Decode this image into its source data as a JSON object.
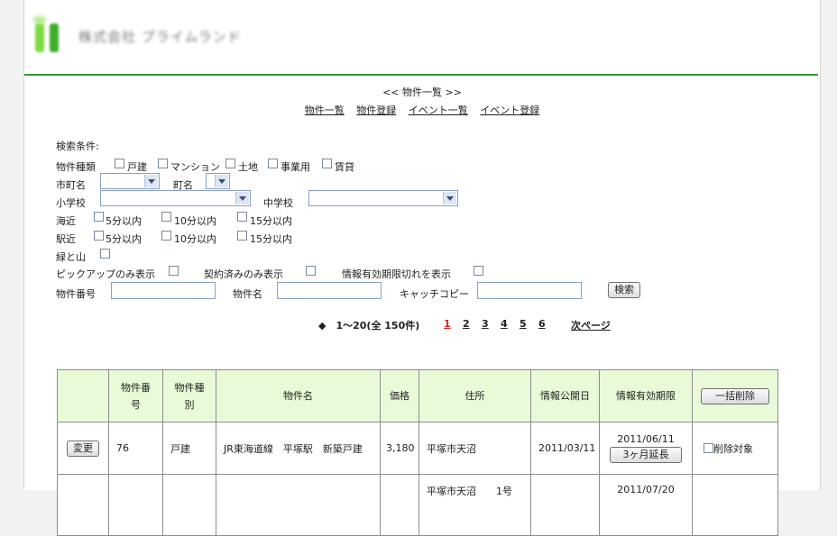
{
  "header": {
    "company_name": "株式会社 プライムランド"
  },
  "nav": {
    "title": "<< 物件一覧 >>",
    "links": [
      "物件一覧",
      "物件登録",
      "イベント一覧",
      "イベント登録"
    ]
  },
  "search": {
    "heading": "検索条件:",
    "type_label": "物件種類",
    "types": [
      "戸建",
      "マンション",
      "土地",
      "事業用",
      "賃貸"
    ],
    "city_label": "市町名",
    "town_label": "町名",
    "elem_school_label": "小学校",
    "mid_school_label": "中学校",
    "sea_label": "海近",
    "station_label": "駅近",
    "distance_options": [
      "5分以内",
      "10分以内",
      "15分以内"
    ],
    "green_label": "緑と山",
    "pickup_label": "ピックアップのみ表示",
    "contracted_label": "契約済みのみ表示",
    "expired_label": "情報有効期限切れを表示",
    "number_label": "物件番号",
    "name_label": "物件名",
    "catch_label": "キャッチコピー",
    "search_button": "検索"
  },
  "pager": {
    "range": "◆　1〜20(全 150件)",
    "pages": [
      "1",
      "2",
      "3",
      "4",
      "5",
      "6"
    ],
    "current": "1",
    "next": "次ページ"
  },
  "table": {
    "headers": [
      "",
      "物件番号",
      "物件種別",
      "物件名",
      "価格",
      "住所",
      "情報公開日",
      "情報有効期限"
    ],
    "bulk_delete_button": "一括削除",
    "rows": [
      {
        "edit_button": "変更",
        "number": "76",
        "type": "戸建",
        "name": "JR東海道線　平塚駅　新築戸建",
        "price": "3,180",
        "address": "平塚市天沼",
        "published": "2011/03/11",
        "expires": "2011/06/11",
        "extend_button": "3ヶ月延長",
        "delete_label": "削除対象"
      },
      {
        "address": "平塚市天沼　　1号",
        "expires": "2011/07/20"
      }
    ]
  }
}
